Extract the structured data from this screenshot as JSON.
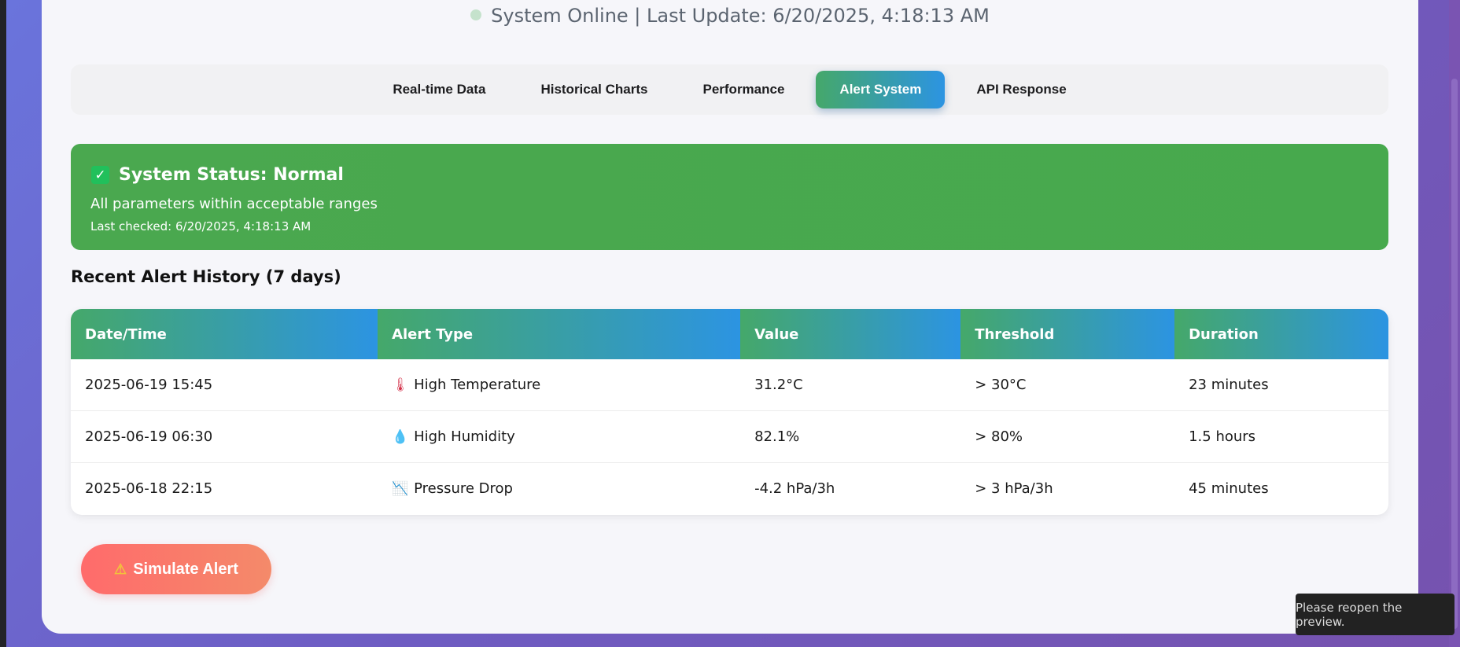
{
  "header": {
    "status_text": "System Online | Last Update: 6/20/2025, 4:18:13 AM"
  },
  "tabs": [
    {
      "label": "Real-time Data"
    },
    {
      "label": "Historical Charts"
    },
    {
      "label": "Performance"
    },
    {
      "label": "Alert System"
    },
    {
      "label": "API Response"
    }
  ],
  "status_card": {
    "title": "System Status: Normal",
    "subtitle": "All parameters within acceptable ranges",
    "last_checked": "Last checked: 6/20/2025, 4:18:13 AM"
  },
  "history": {
    "title": "Recent Alert History (7 days)",
    "columns": [
      "Date/Time",
      "Alert Type",
      "Value",
      "Threshold",
      "Duration"
    ],
    "rows": [
      {
        "datetime": "2025-06-19 15:45",
        "type": "High Temperature",
        "icon": "thermometer-icon",
        "value": "31.2°C",
        "threshold": "> 30°C",
        "duration": "23 minutes"
      },
      {
        "datetime": "2025-06-19 06:30",
        "type": "High Humidity",
        "icon": "droplet-icon",
        "value": "82.1%",
        "threshold": "> 80%",
        "duration": "1.5 hours"
      },
      {
        "datetime": "2025-06-18 22:15",
        "type": "Pressure Drop",
        "icon": "chart-decreasing-icon",
        "value": "-4.2 hPa/3h",
        "threshold": "> 3 hPa/3h",
        "duration": "45 minutes"
      }
    ]
  },
  "simulate_button": {
    "label": "Simulate Alert"
  },
  "toast": {
    "text": "Please reopen the preview."
  },
  "colors": {
    "accent_green": "#45a86a",
    "accent_blue": "#2c94e2",
    "status_green": "#4aa84f",
    "alert_red": "#ff6b6b"
  }
}
